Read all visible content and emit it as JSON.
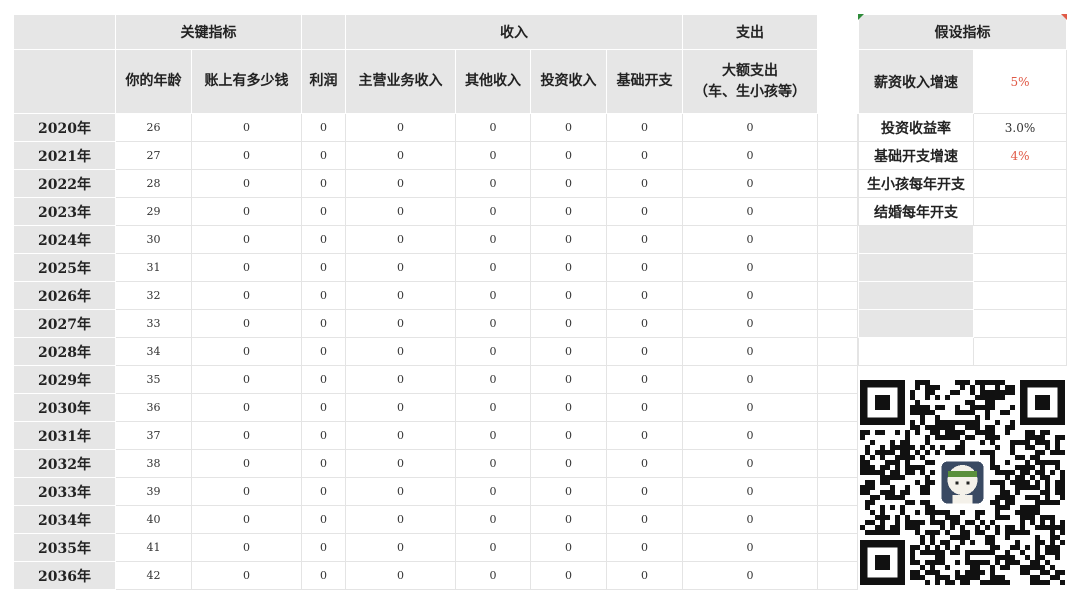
{
  "header": {
    "group_key": "关键指标",
    "group_income": "收入",
    "group_expense": "支出",
    "col_age": "你的年龄",
    "col_balance": "账上有多少钱",
    "col_profit": "利润",
    "col_main_income": "主营业务收入",
    "col_other_income": "其他收入",
    "col_invest_income": "投资收入",
    "col_basic_expense": "基础开支",
    "col_big_expense_line1": "大额支出",
    "col_big_expense_line2": "（车、生小孩等）"
  },
  "rows": [
    {
      "year": "2020年",
      "age": "26",
      "balance": "0",
      "profit": "0",
      "main": "0",
      "other": "0",
      "invest": "0",
      "basic": "0",
      "big": "0"
    },
    {
      "year": "2021年",
      "age": "27",
      "balance": "0",
      "profit": "0",
      "main": "0",
      "other": "0",
      "invest": "0",
      "basic": "0",
      "big": "0"
    },
    {
      "year": "2022年",
      "age": "28",
      "balance": "0",
      "profit": "0",
      "main": "0",
      "other": "0",
      "invest": "0",
      "basic": "0",
      "big": "0"
    },
    {
      "year": "2023年",
      "age": "29",
      "balance": "0",
      "profit": "0",
      "main": "0",
      "other": "0",
      "invest": "0",
      "basic": "0",
      "big": "0"
    },
    {
      "year": "2024年",
      "age": "30",
      "balance": "0",
      "profit": "0",
      "main": "0",
      "other": "0",
      "invest": "0",
      "basic": "0",
      "big": "0"
    },
    {
      "year": "2025年",
      "age": "31",
      "balance": "0",
      "profit": "0",
      "main": "0",
      "other": "0",
      "invest": "0",
      "basic": "0",
      "big": "0"
    },
    {
      "year": "2026年",
      "age": "32",
      "balance": "0",
      "profit": "0",
      "main": "0",
      "other": "0",
      "invest": "0",
      "basic": "0",
      "big": "0"
    },
    {
      "year": "2027年",
      "age": "33",
      "balance": "0",
      "profit": "0",
      "main": "0",
      "other": "0",
      "invest": "0",
      "basic": "0",
      "big": "0"
    },
    {
      "year": "2028年",
      "age": "34",
      "balance": "0",
      "profit": "0",
      "main": "0",
      "other": "0",
      "invest": "0",
      "basic": "0",
      "big": "0"
    },
    {
      "year": "2029年",
      "age": "35",
      "balance": "0",
      "profit": "0",
      "main": "0",
      "other": "0",
      "invest": "0",
      "basic": "0",
      "big": "0"
    },
    {
      "year": "2030年",
      "age": "36",
      "balance": "0",
      "profit": "0",
      "main": "0",
      "other": "0",
      "invest": "0",
      "basic": "0",
      "big": "0"
    },
    {
      "year": "2031年",
      "age": "37",
      "balance": "0",
      "profit": "0",
      "main": "0",
      "other": "0",
      "invest": "0",
      "basic": "0",
      "big": "0"
    },
    {
      "year": "2032年",
      "age": "38",
      "balance": "0",
      "profit": "0",
      "main": "0",
      "other": "0",
      "invest": "0",
      "basic": "0",
      "big": "0"
    },
    {
      "year": "2033年",
      "age": "39",
      "balance": "0",
      "profit": "0",
      "main": "0",
      "other": "0",
      "invest": "0",
      "basic": "0",
      "big": "0"
    },
    {
      "year": "2034年",
      "age": "40",
      "balance": "0",
      "profit": "0",
      "main": "0",
      "other": "0",
      "invest": "0",
      "basic": "0",
      "big": "0"
    },
    {
      "year": "2035年",
      "age": "41",
      "balance": "0",
      "profit": "0",
      "main": "0",
      "other": "0",
      "invest": "0",
      "basic": "0",
      "big": "0"
    },
    {
      "year": "2036年",
      "age": "42",
      "balance": "0",
      "profit": "0",
      "main": "0",
      "other": "0",
      "invest": "0",
      "basic": "0",
      "big": "0"
    }
  ],
  "assumptions": {
    "title": "假设指标",
    "items": [
      {
        "label": "薪资收入增速",
        "value": "5%"
      },
      {
        "label": "投资收益率",
        "value": "3.0%"
      },
      {
        "label": "基础开支增速",
        "value": "4%"
      },
      {
        "label": "生小孩每年开支",
        "value": ""
      },
      {
        "label": "结婚每年开支",
        "value": ""
      }
    ]
  },
  "colors": {
    "header_grey": "#e6e6e6",
    "accent_red": "#e05a47",
    "marker_green": "#2e8b3a"
  },
  "icons": {
    "qr_code": "qr-code-icon",
    "avatar": "avatar-icon"
  }
}
